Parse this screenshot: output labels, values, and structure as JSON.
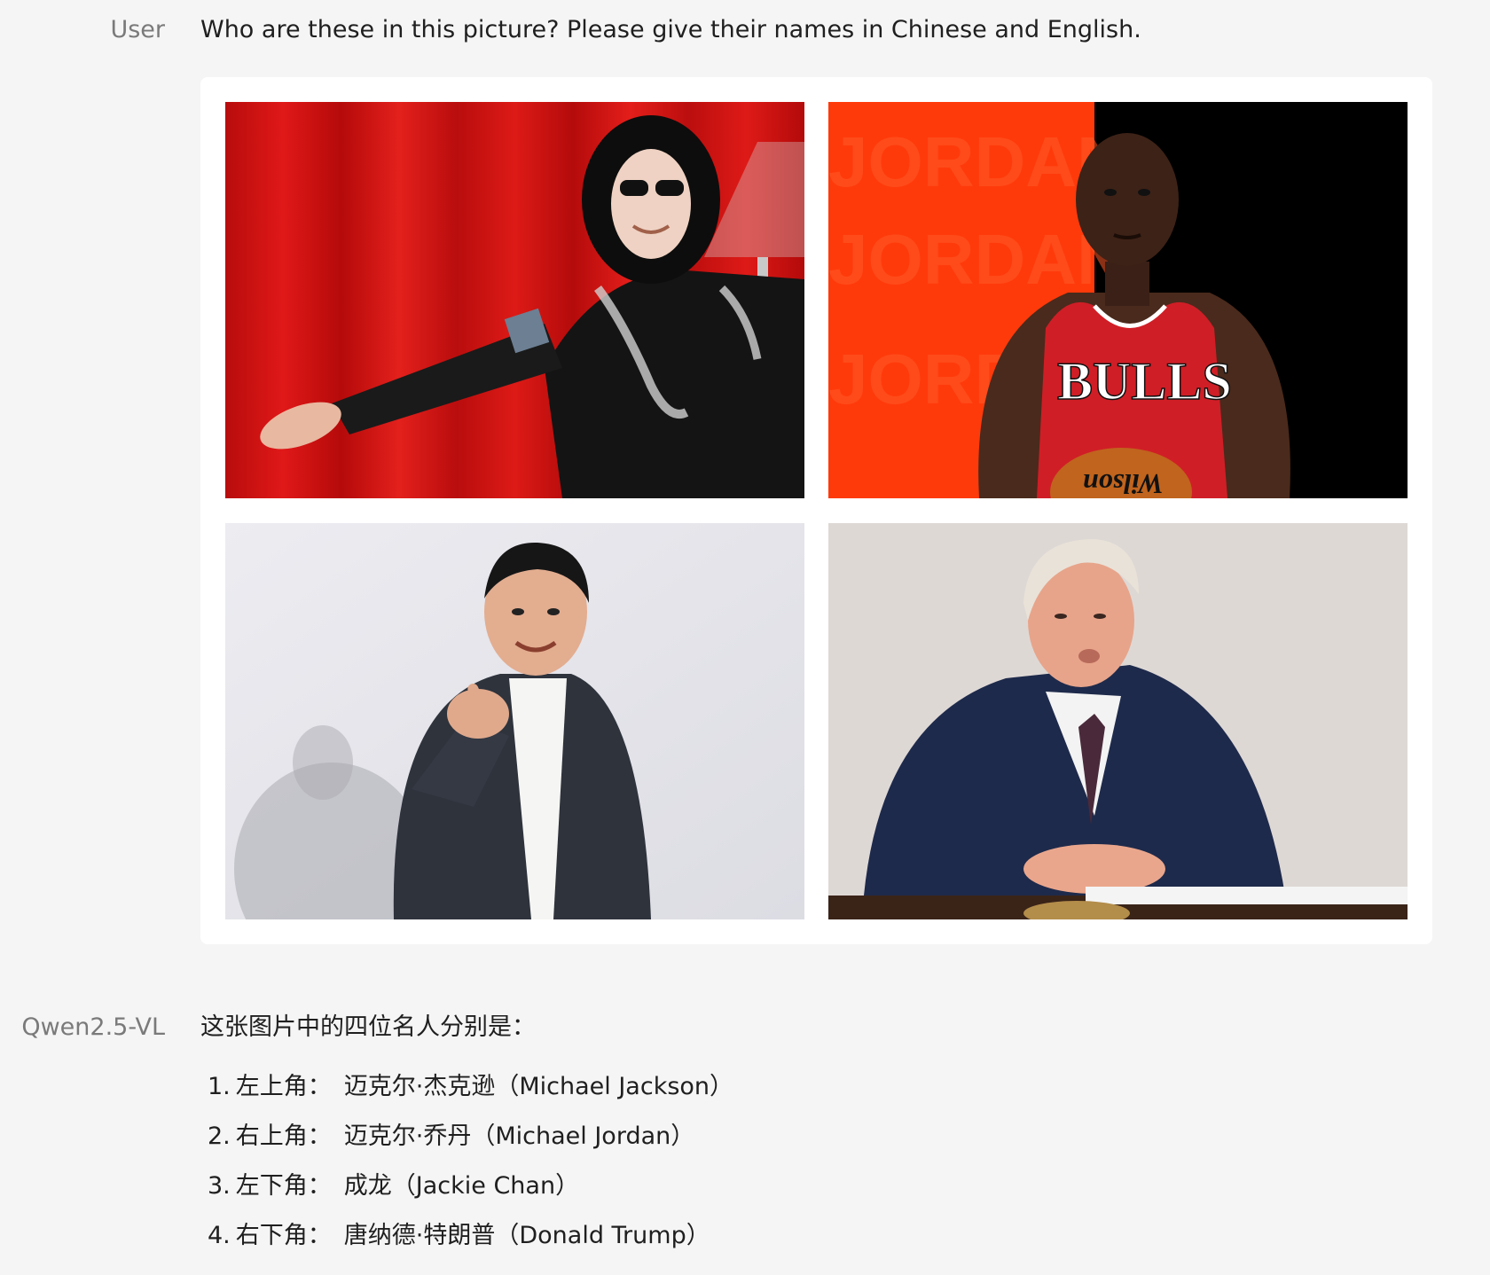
{
  "user": {
    "label": "User",
    "message": "Who are these in this picture? Please give their names in Chinese and English."
  },
  "images": {
    "top_left": {
      "icon": "performer-photo"
    },
    "top_right": {
      "icon": "basketball-player-photo",
      "jersey_text": "BULLS",
      "ball_text": "Wilson",
      "backdrop_text": "JORDAN"
    },
    "bottom_left": {
      "icon": "actor-photo"
    },
    "bottom_right": {
      "icon": "man-at-desk-photo"
    }
  },
  "model": {
    "label": "Qwen2.5-VL",
    "intro": "这张图片中的四位名人分别是：",
    "items": [
      {
        "num": "1.",
        "position": "左上角：",
        "name": "迈克尔·杰克逊（Michael Jackson）"
      },
      {
        "num": "2.",
        "position": "右上角：",
        "name": "迈克尔·乔丹（Michael Jordan）"
      },
      {
        "num": "3.",
        "position": "左下角：",
        "name": "成龙（Jackie Chan）"
      },
      {
        "num": "4.",
        "position": "右下角：",
        "name": "唐纳德·特朗普（Donald Trump）"
      }
    ]
  },
  "colors": {
    "background": "#f5f5f5",
    "card": "#ffffff",
    "label": "#7a7a7a",
    "text": "#1f1f1f"
  }
}
